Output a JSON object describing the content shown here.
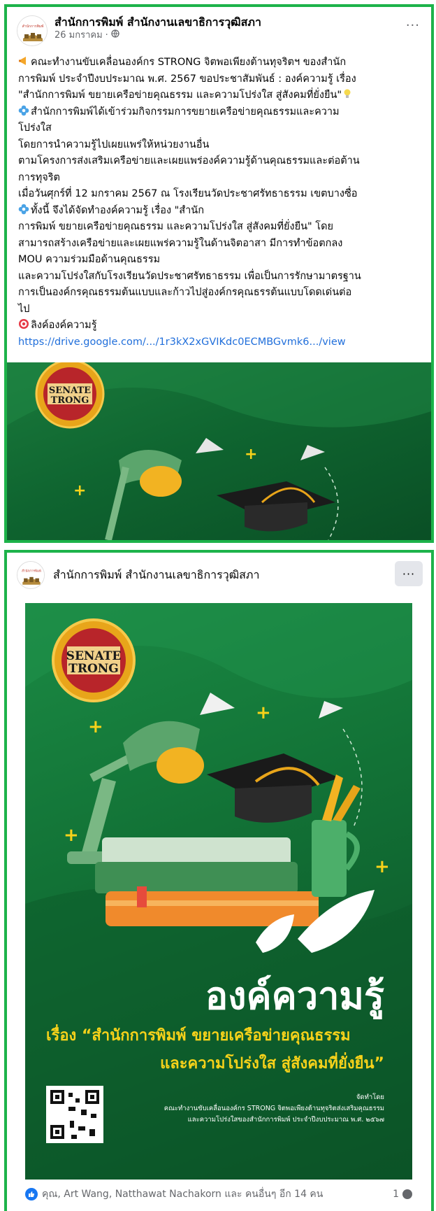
{
  "post1": {
    "page_name": "สำนักการพิมพ์ สำนักงานเลขาธิการวุฒิสภา",
    "date": "26 มกราคม",
    "separator": "·",
    "more_label": "···",
    "body_lines": [
      "คณะทำงานขับเคลื่อนองค์กร STRONG จิตพอเพียงต้านทุจริตฯ ของสำนัก",
      "การพิมพ์ ประจำปีงบประมาณ พ.ศ. 2567 ขอประชาสัมพันธ์ : องค์ความรู้ เรื่อง",
      "\"สำนักการพิมพ์ ขยายเครือข่ายคุณธรรม และความโปร่งใส สู่สังคมที่ยั่งยืน\"",
      "สำนักการพิมพ์ได้เข้าร่วมกิจกรรมการขยายเครือข่ายคุณธรรมและความ",
      "โปร่งใส",
      "โดยการนำความรู้ไปเผยแพร่ให้หน่วยงานอื่น",
      "ตามโครงการส่งเสริมเครือข่ายและเผยแพร่องค์ความรู้ด้านคุณธรรมและต่อต้าน",
      "การทุจริต",
      "เมื่อวันศุกร์ที่ 12 มกราคม 2567 ณ โรงเรียนวัดประชาศรัทธาธรรม เขตบางซื่อ",
      "ทั้งนี้ จึงได้จัดทำองค์ความรู้ เรื่อง \"สำนัก",
      "การพิมพ์ ขยายเครือข่ายคุณธรรม และความโปร่งใส สู่สังคมที่ยั่งยืน\" โดย",
      "สามารถสร้างเครือข่ายและเผยแพร่ความรู้ในด้านจิตอาสา มีการทำข้อตกลง",
      "MOU ความร่วมมือด้านคุณธรรม",
      "และความโปร่งใสกับโรงเรียนวัดประชาศรัทธาธรรม เพื่อเป็นการรักษามาตรฐาน",
      "การเป็นองค์กรคุณธรรมต้นแบบและก้าวไปสู่องค์กรคุณธรรต้นแบบโดดเด่นต่อ",
      "ไป",
      "ลิงค์องค์ความรู้"
    ],
    "link": "https://drive.google.com/.../1r3kX2xGVIKdc0ECMBGvmk6.../view"
  },
  "post2": {
    "page_name": "สำนักการพิมพ์ สำนักงานเลขาธิการวุฒิสภา",
    "more_label": "···",
    "poster": {
      "badge_top": "SENATE",
      "badge_bottom": "TRONG",
      "title": "องค์ความรู้",
      "subtitle_line1": "เรื่อง “สำนักการพิมพ์ ขยายเครือข่ายคุณธรรม",
      "subtitle_line2": "และความโปร่งใส สู่สังคมที่ยั่งยืน”",
      "organizer_label": "จัดทำโดย",
      "organizer_line1": "คณะทำงานขับเคลื่อนองค์กร STRONG จิตพอเพียงต้านทุจริตส่งเสริมคุณธรรม",
      "organizer_line2": "และความโปร่งใสของสำนักการพิมพ์ ประจำปีงบประมาณ พ.ศ. ๒๕๖๗"
    },
    "reactions_text": "คุณ, Art Wang, Natthawat Nachakorn และ คนอื่นๆ อีก 14 คน",
    "comment_count": "1"
  },
  "colors": {
    "accent_border": "#1db34a",
    "link": "#216fdb",
    "poster_green": "#127236",
    "poster_yellow": "#f7d21a",
    "like_blue": "#1877f2"
  },
  "icons": {
    "globe": "globe-icon",
    "more": "more-options-icon",
    "like": "like-icon",
    "comment": "comment-icon",
    "lamp": "desk-lamp-icon",
    "graduation_cap": "graduation-cap-icon",
    "paper_plane": "paper-plane-icon",
    "books": "books-icon",
    "qr": "qr-code-icon",
    "leaf": "leaf-icon"
  }
}
